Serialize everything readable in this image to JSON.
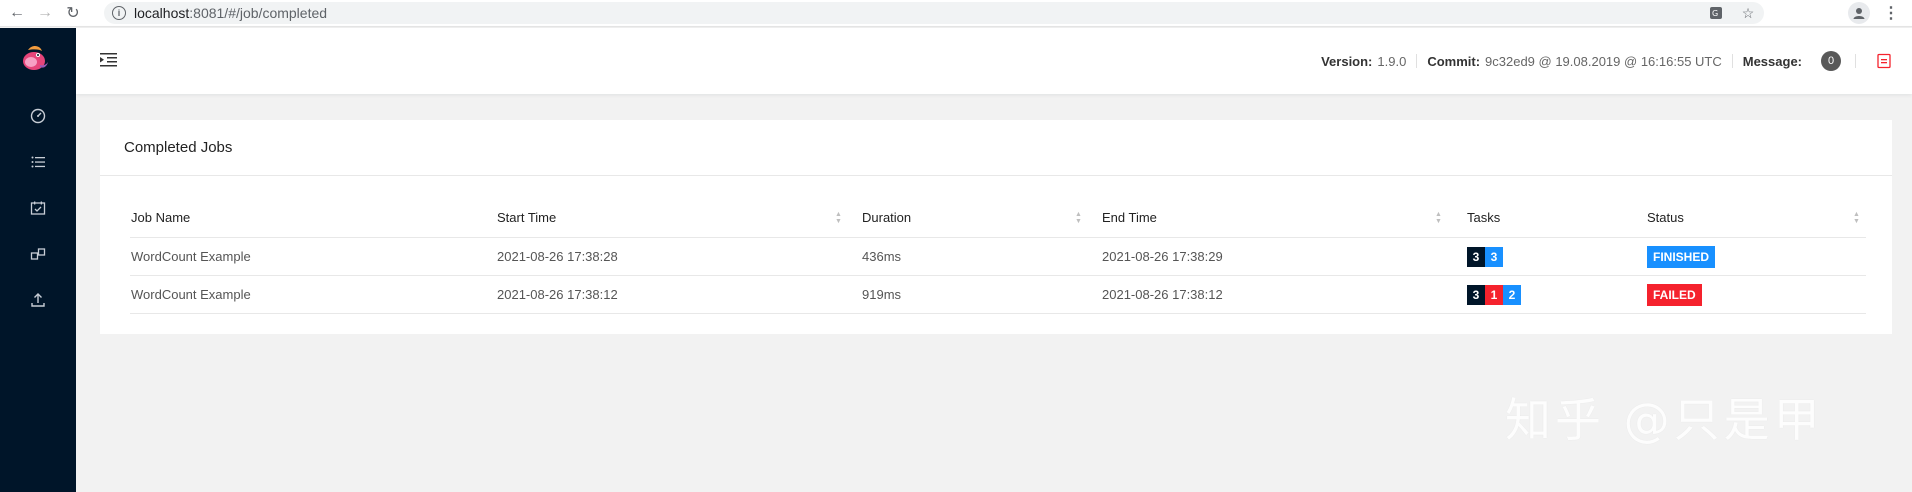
{
  "browser": {
    "url_host": "localhost",
    "url_path": ":8081/#/job/completed"
  },
  "header": {
    "version_label": "Version:",
    "version_value": "1.9.0",
    "commit_label": "Commit:",
    "commit_value": "9c32ed9 @ 19.08.2019 @ 16:16:55 UTC",
    "message_label": "Message:",
    "message_count": "0"
  },
  "card": {
    "title": "Completed Jobs"
  },
  "table": {
    "columns": [
      "Job Name",
      "Start Time",
      "Duration",
      "End Time",
      "Tasks",
      "Status"
    ],
    "rows": [
      {
        "job_name": "WordCount Example",
        "start_time": "2021-08-26 17:38:28",
        "duration": "436ms",
        "end_time": "2021-08-26 17:38:29",
        "tasks": [
          {
            "value": "3",
            "color": "#001529"
          },
          {
            "value": "3",
            "color": "#1890ff"
          }
        ],
        "status": "FINISHED"
      },
      {
        "job_name": "WordCount Example",
        "start_time": "2021-08-26 17:38:12",
        "duration": "919ms",
        "end_time": "2021-08-26 17:38:12",
        "tasks": [
          {
            "value": "3",
            "color": "#001529"
          },
          {
            "value": "1",
            "color": "#f5222d"
          },
          {
            "value": "2",
            "color": "#1890ff"
          }
        ],
        "status": "FAILED"
      }
    ]
  },
  "colors": {
    "sidebar": "#001529",
    "finished": "#1890ff",
    "failed": "#f5222d"
  },
  "watermark": "知乎 @只是甲"
}
